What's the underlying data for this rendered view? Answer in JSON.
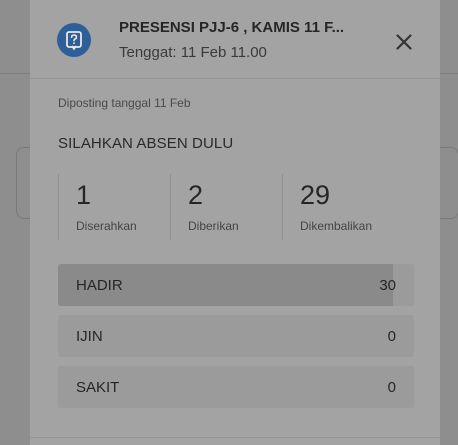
{
  "assignment": {
    "title": "PRESENSI PJJ-6 , KAMIS 11 F...",
    "due": "Tenggat: 11 Feb 11.00",
    "posted": "Diposting tanggal 11 Feb",
    "instructions": "SILAHKAN ABSEN DULU",
    "icon": "assignment-question-icon"
  },
  "stats": [
    {
      "value": "1",
      "label": "Diserahkan"
    },
    {
      "value": "2",
      "label": "Diberikan"
    },
    {
      "value": "29",
      "label": "Dikembalikan"
    }
  ],
  "options": [
    {
      "label": "HADIR",
      "count": "30",
      "fraction": 0.94
    },
    {
      "label": "IJIN",
      "count": "0",
      "fraction": 0
    },
    {
      "label": "SAKIT",
      "count": "0",
      "fraction": 0
    }
  ],
  "colors": {
    "accent": "#2f5f99",
    "overlay": "#8e8e8e",
    "sheet": "#a3a3a3"
  }
}
